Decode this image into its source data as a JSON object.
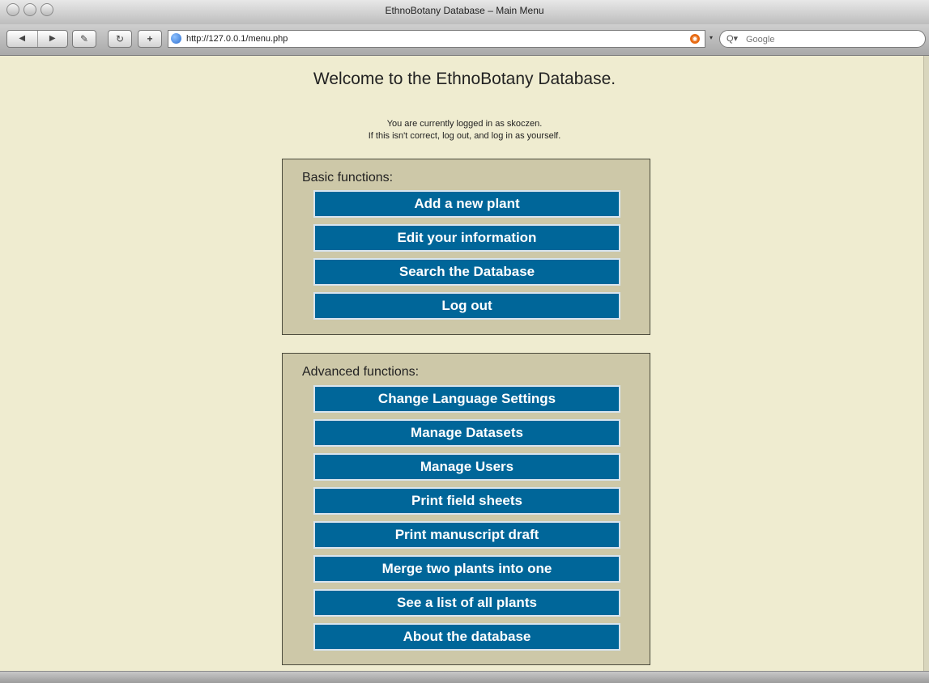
{
  "window": {
    "title": "EthnoBotany Database – Main Menu"
  },
  "toolbar": {
    "back_icon": "back-arrow-icon",
    "forward_icon": "forward-arrow-icon",
    "url": "http://127.0.0.1/menu.php",
    "search_placeholder": "Google",
    "search_icon": "Q▾"
  },
  "page": {
    "welcome": "Welcome to the EthnoBotany Database.",
    "login_line1": "You are currently logged in as skoczen.",
    "login_line2": "If this isn't correct, log out, and log in as yourself."
  },
  "basic": {
    "label": "Basic functions:",
    "buttons": [
      "Add a new plant",
      "Edit your information",
      "Search the Database",
      "Log out"
    ]
  },
  "advanced": {
    "label": "Advanced functions:",
    "buttons": [
      "Change Language Settings",
      "Manage Datasets",
      "Manage Users",
      "Print field sheets",
      "Print manuscript draft",
      "Merge two plants into one",
      "See a list of all plants",
      "About the database"
    ]
  },
  "colors": {
    "page_bg": "#efecd0",
    "panel_bg": "#cdc8a8",
    "button_bg": "#006699",
    "button_text": "#ffffff"
  }
}
